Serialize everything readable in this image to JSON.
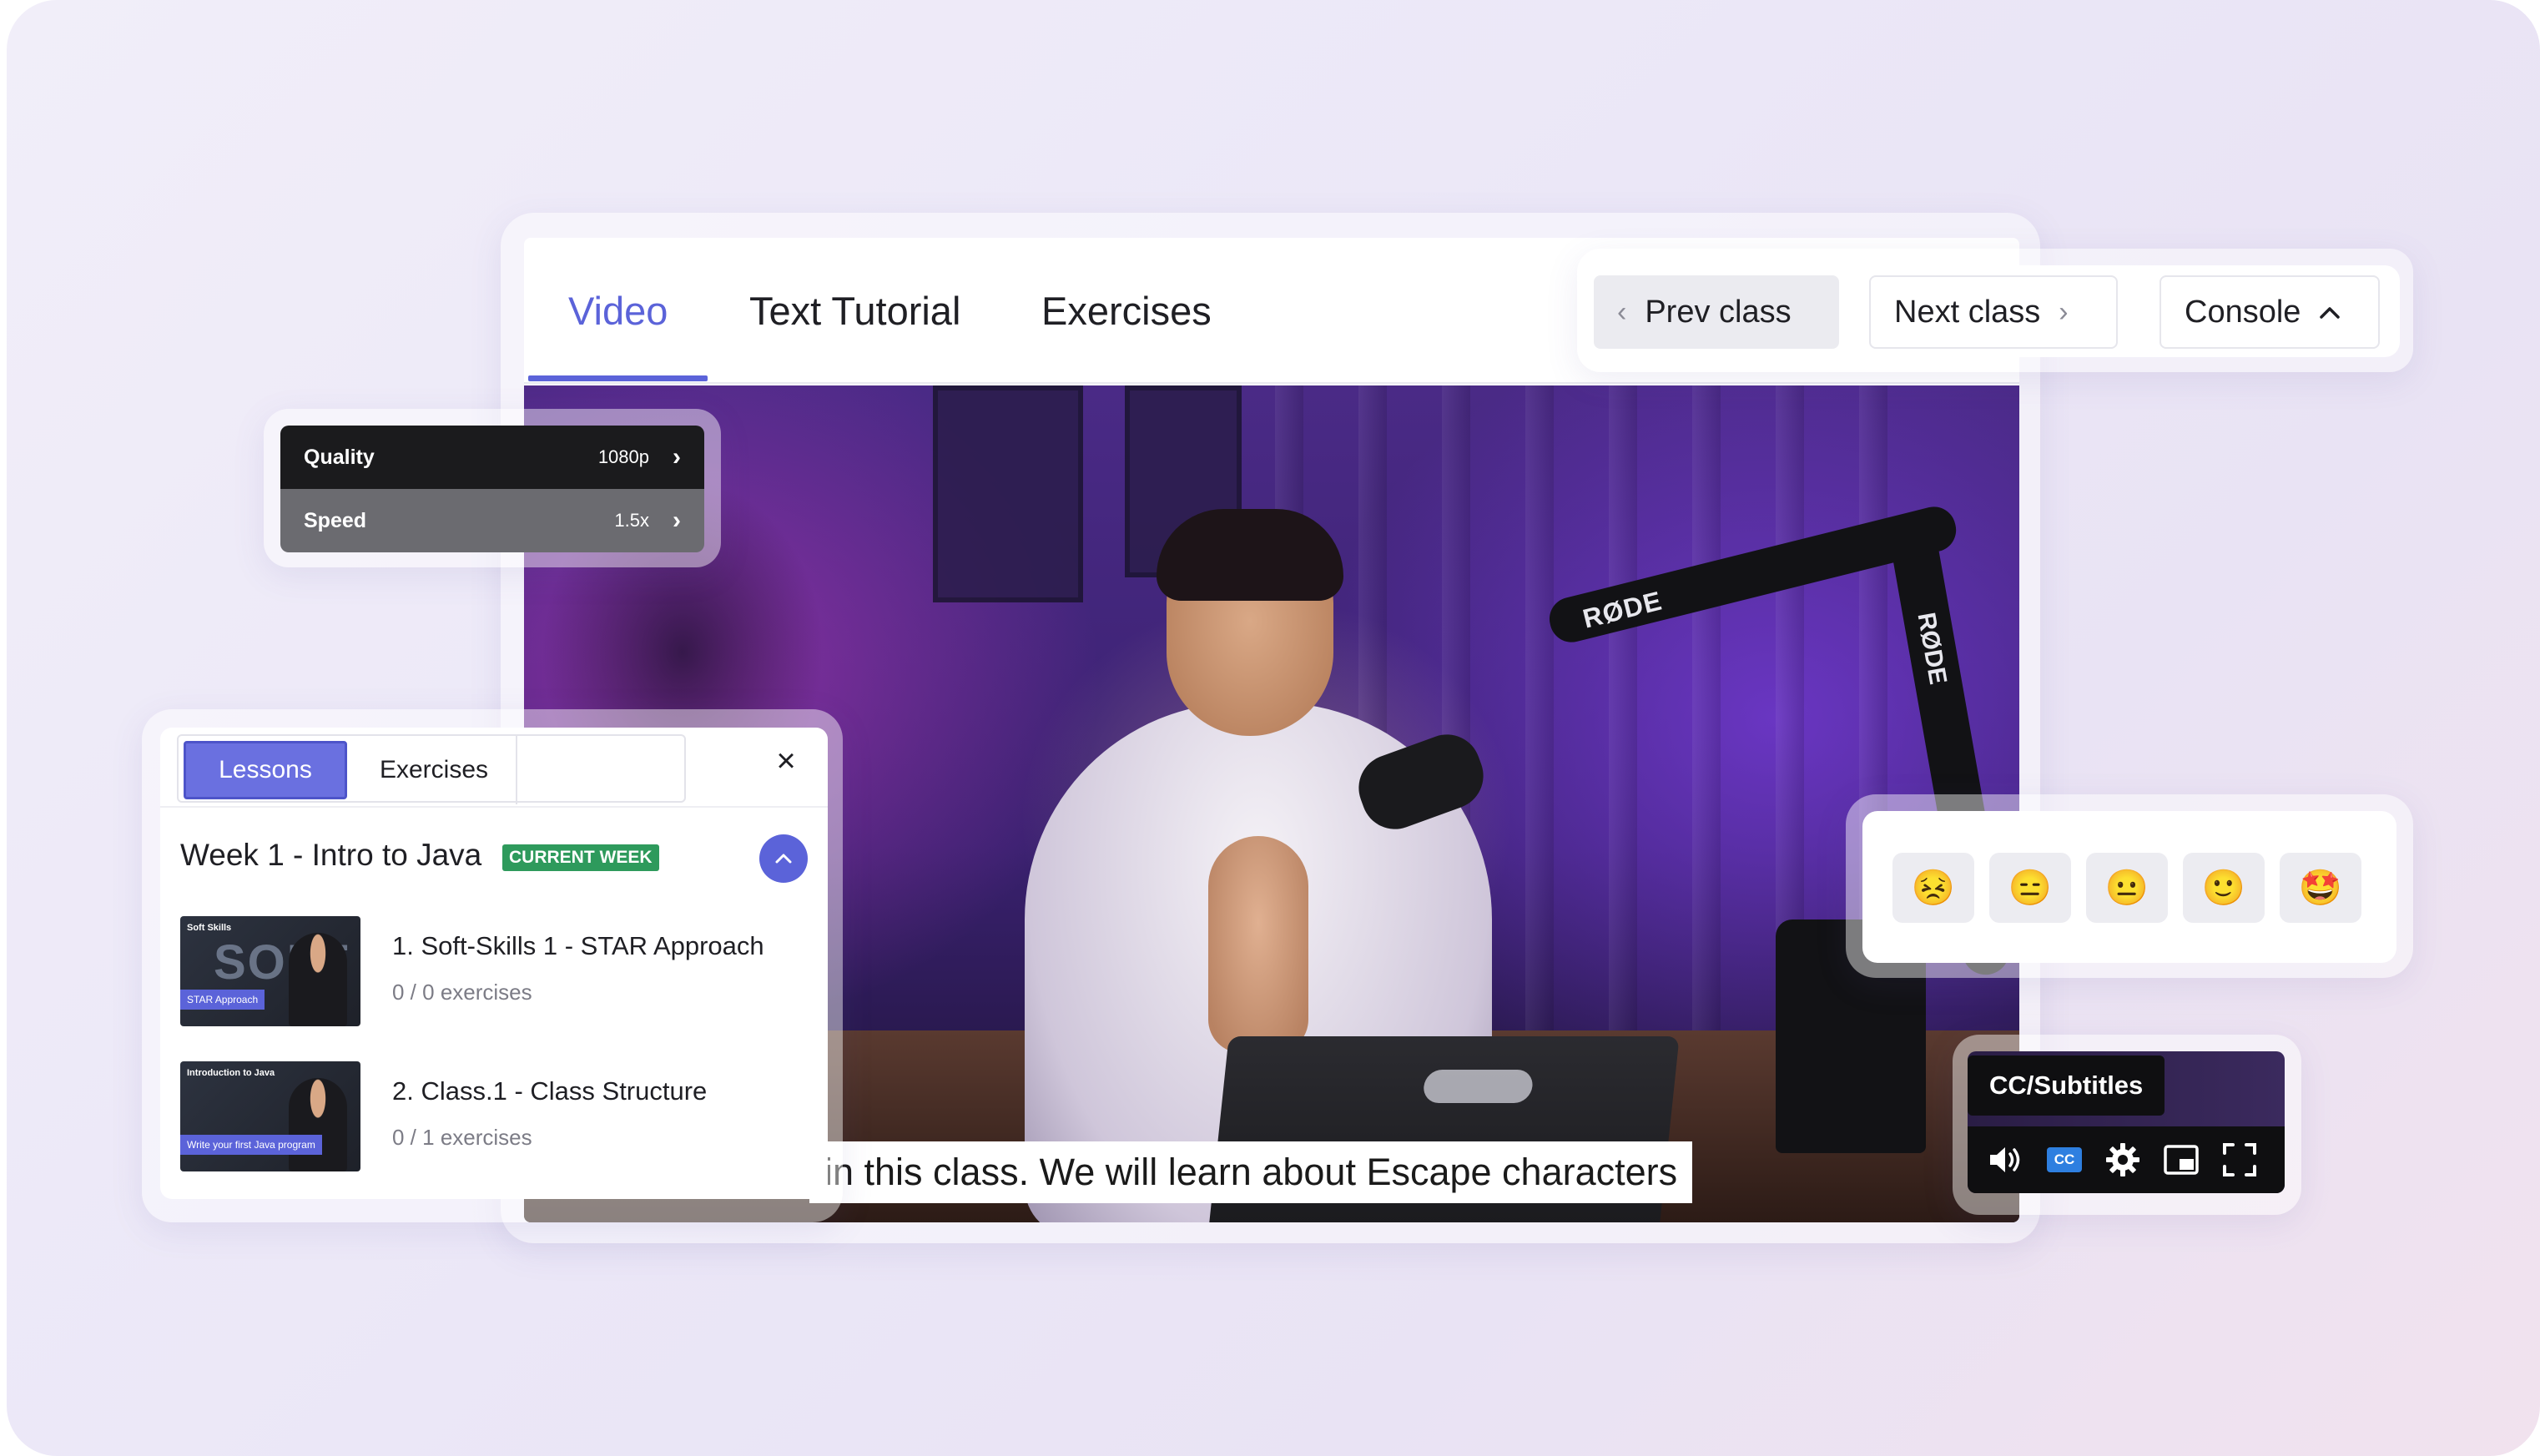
{
  "player": {
    "tabs": [
      {
        "label": "Video",
        "active": true
      },
      {
        "label": "Text Tutorial",
        "active": false
      },
      {
        "label": "Exercises",
        "active": false
      }
    ],
    "subtitle_text": "in this class. We will learn about Escape characters",
    "video_props": {
      "arm_brand": "RØDE",
      "pole_brand": "RØDE"
    }
  },
  "nav": {
    "prev_label": "Prev class",
    "next_label": "Next class",
    "console_label": "Console"
  },
  "settings_menu": {
    "quality_label": "Quality",
    "quality_value": "1080p",
    "speed_label": "Speed",
    "speed_value": "1.5x"
  },
  "lessons_panel": {
    "tab_lessons": "Lessons",
    "tab_exercises": "Exercises",
    "week_title": "Week 1 - Intro to Java",
    "week_badge": "CURRENT WEEK",
    "lessons": [
      {
        "title": "1. Soft-Skills 1 - STAR Approach",
        "exercises": "0 / 0 exercises",
        "thumb_heading": "Soft Skills",
        "thumb_big": "SOFT",
        "thumb_tag": "STAR Approach"
      },
      {
        "title": "2. Class.1 - Class Structure",
        "exercises": "0 / 1 exercises",
        "thumb_heading": "Introduction to Java",
        "thumb_big": "",
        "thumb_tag": "Write your first Java program"
      }
    ]
  },
  "reactions": [
    "😣",
    "😑",
    "😐",
    "🙂",
    "🤩"
  ],
  "cc": {
    "tooltip": "CC/Subtitles",
    "badge": "CC"
  },
  "colors": {
    "accent": "#5b63d9",
    "badge_green": "#2e9a5c"
  }
}
